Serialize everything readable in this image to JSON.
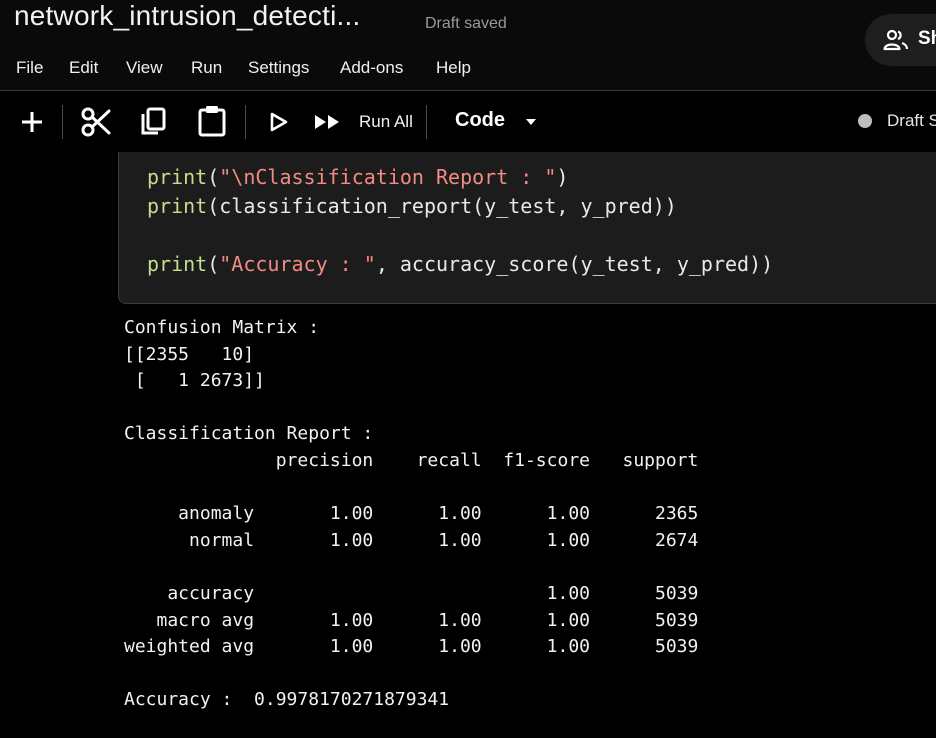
{
  "app": {
    "notebook_title": "network_intrusion_detecti...",
    "save_status": "Draft saved",
    "share_label": "Sh"
  },
  "menu": {
    "items": [
      "File",
      "Edit",
      "View",
      "Run",
      "Settings",
      "Add-ons",
      "Help"
    ]
  },
  "toolbar": {
    "icons": [
      "plus-icon",
      "scissors-icon",
      "copy-icon",
      "clipboard-icon",
      "play-icon",
      "fast-forward-icon"
    ],
    "run_all_label": "Run All",
    "cell_type": "Code",
    "status_label": "Draft S"
  },
  "cell": {
    "code_lines": [
      {
        "fn": "print",
        "args": "(\"\\nClassification Report : \")"
      },
      {
        "fn": "print",
        "args": "(classification_report(y_test, y_pred))"
      },
      {
        "fn": "",
        "args": ""
      },
      {
        "fn": "print",
        "args": "(\"Accuracy : \", accuracy_score(y_test, y_pred))"
      }
    ],
    "code_text": [
      "print(\"\\nClassification Report : \")",
      "print(classification_report(y_test, y_pred))",
      "",
      "print(\"Accuracy : \", accuracy_score(y_test, y_pred))"
    ]
  },
  "output": {
    "text": "Confusion Matrix :\n[[2355   10]\n [   1 2673]]\n\nClassification Report :\n              precision    recall  f1-score   support\n\n     anomaly       1.00      1.00      1.00      2365\n      normal       1.00      1.00      1.00      2674\n\n    accuracy                           1.00      5039\n   macro avg       1.00      1.00      1.00      5039\nweighted avg       1.00      1.00      1.00      5039\n\nAccuracy :  0.9978170271879341"
  }
}
